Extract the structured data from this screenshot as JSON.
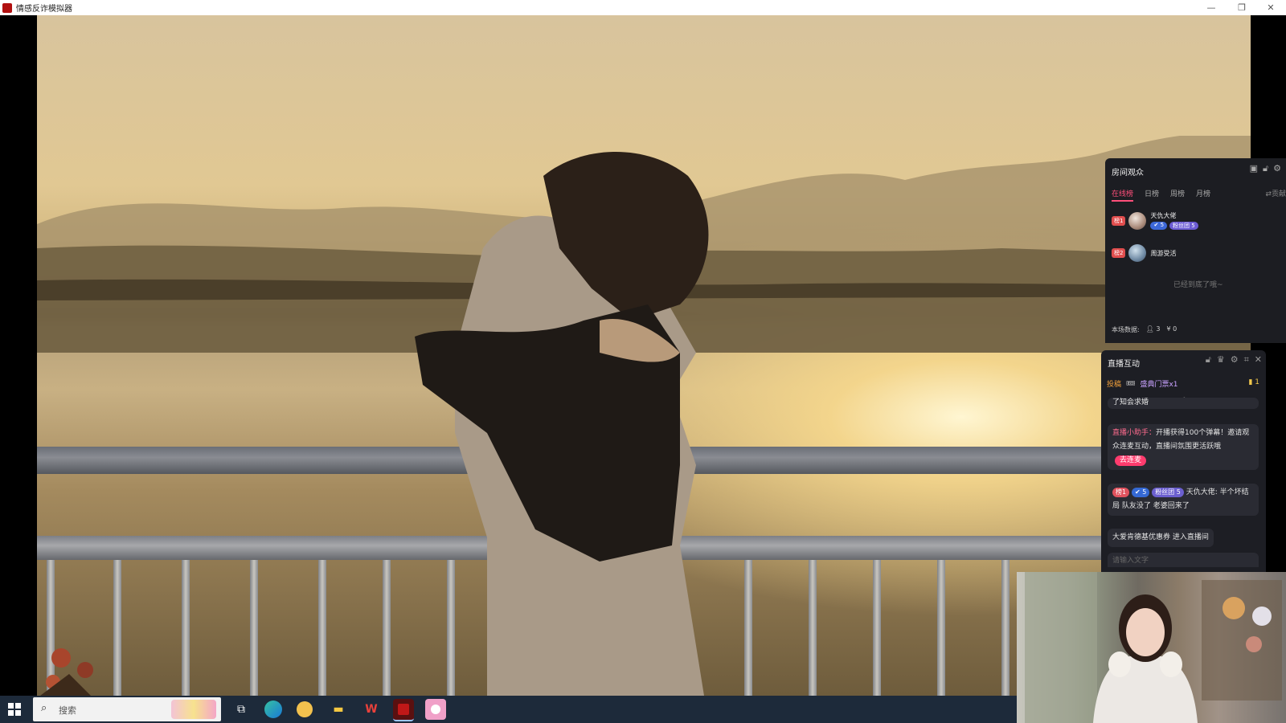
{
  "window": {
    "title": "情感反诈模拟器",
    "minimize_glyph": "—",
    "restore_glyph": "❐",
    "close_glyph": "✕"
  },
  "audience_panel": {
    "title": "房间观众",
    "tabs": [
      {
        "label": "在线榜",
        "active": true
      },
      {
        "label": "日榜",
        "active": false
      },
      {
        "label": "周榜",
        "active": false
      },
      {
        "label": "月榜",
        "active": false
      }
    ],
    "tab_more": "⇄贡献",
    "viewers": [
      {
        "rank": "榜1",
        "name": "天仇大佬",
        "level": "5",
        "fan_badge": "粉丝团 5"
      },
      {
        "rank": "榜2",
        "name": "周游受活",
        "level": "",
        "fan_badge": ""
      }
    ],
    "bottom_tip": "已经到底了哦~",
    "stats_label": "本场数据:",
    "viewer_count": "3",
    "revenue": "0"
  },
  "interaction_panel": {
    "title": "直播互动",
    "gift_label": "投稿",
    "gift_name": "盛典门票x1",
    "gift_count": "1",
    "partial_msg": "了知会求婚",
    "messages": [
      {
        "prefix": "直播小助手：",
        "text": "开播获得100个弹幕！邀请观众连麦互动，直播间氛围更活跃哦",
        "button": "去连麦"
      },
      {
        "rank": "榜1",
        "level": "5",
        "fan": "粉丝团 5",
        "user": "天仇大佬:",
        "text": "半个坏结局 队友没了 老婆回来了"
      },
      {
        "text": "大爱肯德基优惠券 进入直播间"
      }
    ],
    "input_placeholder": "请输入文字"
  },
  "taskbar": {
    "search_placeholder": "搜索",
    "icons": [
      "windows-start-icon",
      "task-view-icon",
      "edge-browser-icon",
      "folder-app-icon",
      "file-explorer-icon",
      "wps-icon",
      "red-app-icon",
      "live-app-icon"
    ]
  }
}
